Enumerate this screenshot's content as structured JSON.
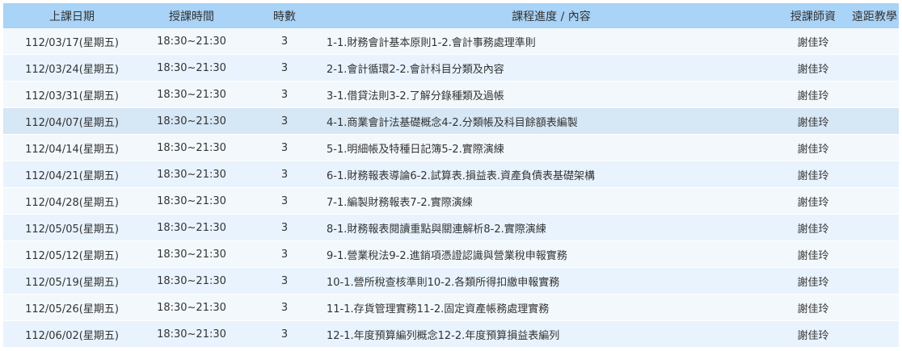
{
  "table": {
    "headers": {
      "date": "上課日期",
      "time": "授課時間",
      "hours": "時數",
      "content": "課程進度 / 內容",
      "teacher": "授課師資",
      "remote": "遠距教學"
    },
    "rows": [
      {
        "date": "112/03/17(星期五)",
        "time": "18:30~21:30",
        "hours": "3",
        "content": "1-1.財務會計基本原則1-2.會計事務處理準則",
        "teacher": "謝佳玲",
        "remote": ""
      },
      {
        "date": "112/03/24(星期五)",
        "time": "18:30~21:30",
        "hours": "3",
        "content": "2-1.會計循環2-2.會計科目分類及內容",
        "teacher": "謝佳玲",
        "remote": ""
      },
      {
        "date": "112/03/31(星期五)",
        "time": "18:30~21:30",
        "hours": "3",
        "content": "3-1.借貸法則3-2.了解分錄種類及過帳",
        "teacher": "謝佳玲",
        "remote": ""
      },
      {
        "date": "112/04/07(星期五)",
        "time": "18:30~21:30",
        "hours": "3",
        "content": "4-1.商業會計法基礎概念4-2.分類帳及科目餘額表編製",
        "teacher": "謝佳玲",
        "remote": ""
      },
      {
        "date": "112/04/14(星期五)",
        "time": "18:30~21:30",
        "hours": "3",
        "content": "5-1.明細帳及特種日記簿5-2.實際演練",
        "teacher": "謝佳玲",
        "remote": ""
      },
      {
        "date": "112/04/21(星期五)",
        "time": "18:30~21:30",
        "hours": "3",
        "content": "6-1.財務報表導論6-2.試算表.損益表.資產負債表基礎架構",
        "teacher": "謝佳玲",
        "remote": ""
      },
      {
        "date": "112/04/28(星期五)",
        "time": "18:30~21:30",
        "hours": "3",
        "content": "7-1.編製財務報表7-2.實際演練",
        "teacher": "謝佳玲",
        "remote": ""
      },
      {
        "date": "112/05/05(星期五)",
        "time": "18:30~21:30",
        "hours": "3",
        "content": "8-1.財務報表閱讀重點與關連解析8-2.實際演練",
        "teacher": "謝佳玲",
        "remote": ""
      },
      {
        "date": "112/05/12(星期五)",
        "time": "18:30~21:30",
        "hours": "3",
        "content": "9-1.營業稅法9-2.進銷項憑證認識與營業稅申報實務",
        "teacher": "謝佳玲",
        "remote": ""
      },
      {
        "date": "112/05/19(星期五)",
        "time": "18:30~21:30",
        "hours": "3",
        "content": "10-1.營所稅查核準則10-2.各類所得扣繳申報實務",
        "teacher": "謝佳玲",
        "remote": ""
      },
      {
        "date": "112/05/26(星期五)",
        "time": "18:30~21:30",
        "hours": "3",
        "content": "11-1.存貨管理實務11-2.固定資產帳務處理實務",
        "teacher": "謝佳玲",
        "remote": ""
      },
      {
        "date": "112/06/02(星期五)",
        "time": "18:30~21:30",
        "hours": "3",
        "content": "12-1.年度預算編列概念12-2.年度預算損益表編列",
        "teacher": "謝佳玲",
        "remote": ""
      }
    ]
  },
  "colors": {
    "header_bg": "#a9d3f7",
    "row_odd": "#f3f8fc",
    "row_even": "#e8f3fd",
    "row_highlight": "#d6e7f5"
  }
}
